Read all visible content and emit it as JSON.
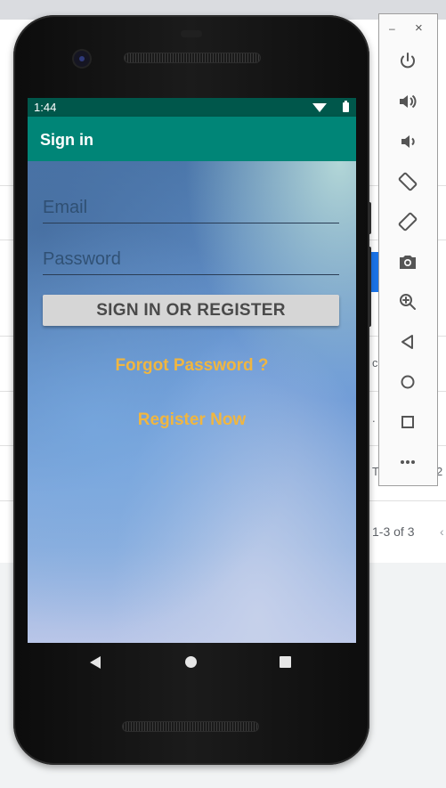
{
  "host": {
    "fragments": [
      "c",
      ". .",
      "T",
      "2"
    ],
    "pager": "1-3 of 3"
  },
  "device": {
    "status_bar": {
      "time": "1:44"
    },
    "app_bar": {
      "title": "Sign in"
    },
    "form": {
      "email_placeholder": "Email",
      "password_placeholder": "Password",
      "submit_label": "SIGN IN OR REGISTER",
      "forgot_password_label": "Forgot Password ?",
      "register_label": "Register Now"
    },
    "nav_bar": {
      "icons": [
        "back-icon",
        "home-icon",
        "recents-icon"
      ]
    }
  },
  "emulator_toolbar": {
    "window_controls": {
      "minimize": "–",
      "close": "×"
    },
    "icons": [
      "power-icon",
      "volume-up-icon",
      "volume-down-icon",
      "rotate-left-icon",
      "rotate-right-icon",
      "camera-icon",
      "zoom-icon",
      "back-icon",
      "home-icon",
      "overview-icon",
      "more-icon"
    ]
  },
  "colors": {
    "status_bar": "#00574b",
    "app_bar": "#008577",
    "link": "#f0b640",
    "button": "#d6d6d6"
  }
}
